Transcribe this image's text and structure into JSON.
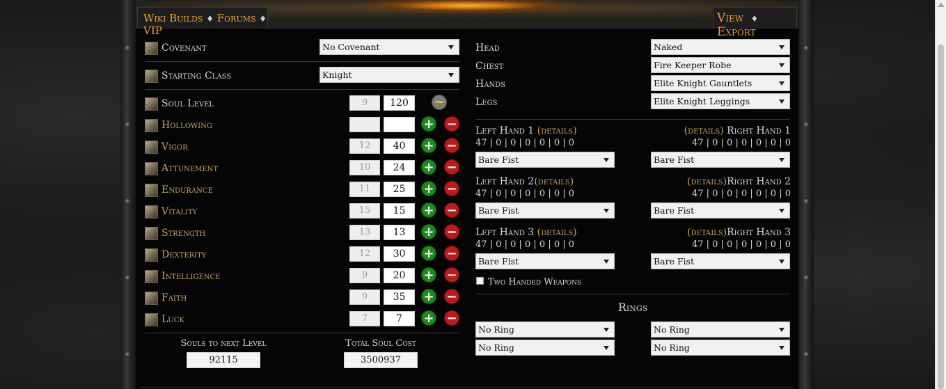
{
  "nav": {
    "wiki_builds": "Wiki Builds",
    "forums": "Forums",
    "vip": "VIP",
    "diamond": "♦",
    "view": "View",
    "export": "Export"
  },
  "left": {
    "covenant": {
      "label": "Covenant",
      "value": "No Covenant"
    },
    "starting_class": {
      "label": "Starting Class",
      "value": "Knight"
    },
    "soul_level": {
      "label": "Soul Level",
      "base": "9",
      "current": "120",
      "auto": "~"
    },
    "stats": [
      {
        "label": "Hollowing",
        "base": "",
        "current": ""
      },
      {
        "label": "Vigor",
        "base": "12",
        "current": "40"
      },
      {
        "label": "Attunement",
        "base": "10",
        "current": "24"
      },
      {
        "label": "Endurance",
        "base": "11",
        "current": "25"
      },
      {
        "label": "Vitality",
        "base": "15",
        "current": "15"
      },
      {
        "label": "Strength",
        "base": "13",
        "current": "13"
      },
      {
        "label": "Dexterity",
        "base": "12",
        "current": "30"
      },
      {
        "label": "Intelligence",
        "base": "9",
        "current": "20"
      },
      {
        "label": "Faith",
        "base": "9",
        "current": "35"
      },
      {
        "label": "Luck",
        "base": "7",
        "current": "7"
      }
    ],
    "plus": "+",
    "minus": "−",
    "souls_next_label": "Souls to next Level",
    "souls_next_value": "92115",
    "total_cost_label": "Total Soul Cost",
    "total_cost_value": "3500937"
  },
  "armor": {
    "head": {
      "label": "Head",
      "value": "Naked"
    },
    "chest": {
      "label": "Chest",
      "value": "Fire Keeper Robe"
    },
    "hands": {
      "label": "Hands",
      "value": "Elite Knight Gauntlets"
    },
    "legs": {
      "label": "Legs",
      "value": "Elite Knight Leggings"
    }
  },
  "weapons": {
    "details": "(details)",
    "left1": {
      "label": "Left Hand 1 ",
      "stats": "47 | 0 | 0 | 0 | 0 | 0 | 0",
      "value": "Bare Fist"
    },
    "right1": {
      "label": " Right Hand 1",
      "stats": "47 | 0 | 0 | 0 | 0 | 0 | 0",
      "value": "Bare Fist"
    },
    "left2": {
      "label": "Left Hand 2",
      "stats": "47 | 0 | 0 | 0 | 0 | 0 | 0",
      "value": "Bare Fist"
    },
    "right2": {
      "label": "Right Hand 2",
      "stats": "47 | 0 | 0 | 0 | 0 | 0 | 0",
      "value": "Bare Fist"
    },
    "left3": {
      "label": "Left Hand 3 ",
      "stats": "47 | 0 | 0 | 0 | 0 | 0 | 0",
      "value": "Bare Fist"
    },
    "right3": {
      "label": "Right Hand 3",
      "stats": "47 | 0 | 0 | 0 | 0 | 0 | 0",
      "value": "Bare Fist"
    },
    "two_handed_label": "Two Handed Weapons"
  },
  "rings": {
    "title": "Rings",
    "slots": [
      "No Ring",
      "No Ring",
      "No Ring",
      "No Ring"
    ]
  }
}
